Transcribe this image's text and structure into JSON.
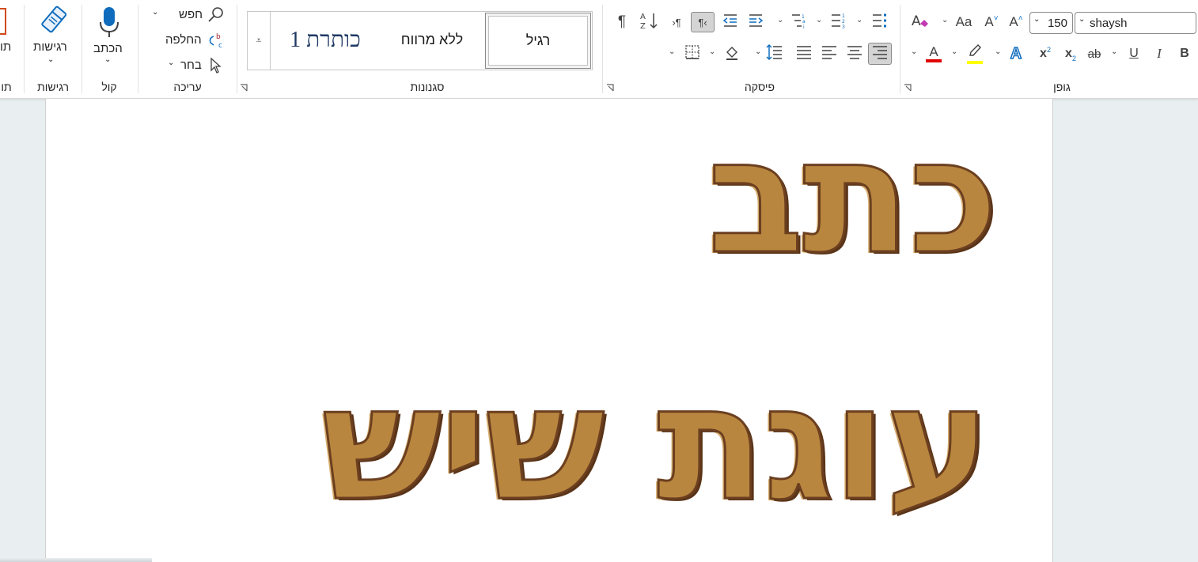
{
  "ribbon": {
    "groups": {
      "font": "גופן",
      "paragraph": "פיסקה",
      "styles": "סגנונות",
      "editing": "עריכה",
      "voice": "קול",
      "sensitivity": "רגישות",
      "partial_left": "תו"
    },
    "font": {
      "name": "shaysh",
      "size": "150",
      "clear_formatting_icon": "clear-formatting-icon",
      "change_case": "Aa",
      "grow_font": "A",
      "shrink_font": "A",
      "bold": "B",
      "italic": "I",
      "underline": "U",
      "strikethrough": "ab",
      "subscript": "x",
      "subscript_mark": "2",
      "superscript": "x",
      "superscript_mark": "2",
      "text_effects": "A",
      "font_color": "A",
      "font_color_hex": "#e00000",
      "highlight_hex": "#ffff00"
    },
    "paragraph": {
      "pilcrow": "¶",
      "sort_icon": "sort-az-icon"
    },
    "styles": {
      "normal": "רגיל",
      "no_spacing": "ללא מרווח",
      "heading1": "כותרת 1"
    },
    "editing": {
      "find": "חפש",
      "replace": "החלפה",
      "select": "בחר"
    },
    "voice": {
      "dictate": "הכתב"
    },
    "sensitivity": {
      "label": "רגישות"
    },
    "partial_left_top": "תו"
  },
  "document": {
    "line1": "כתב",
    "line2": "עוגת שיש"
  },
  "colors": {
    "accent_blue": "#0f6cbd",
    "cookie_light": "#d7ad6e",
    "cookie_dark": "#6b3f1f"
  }
}
